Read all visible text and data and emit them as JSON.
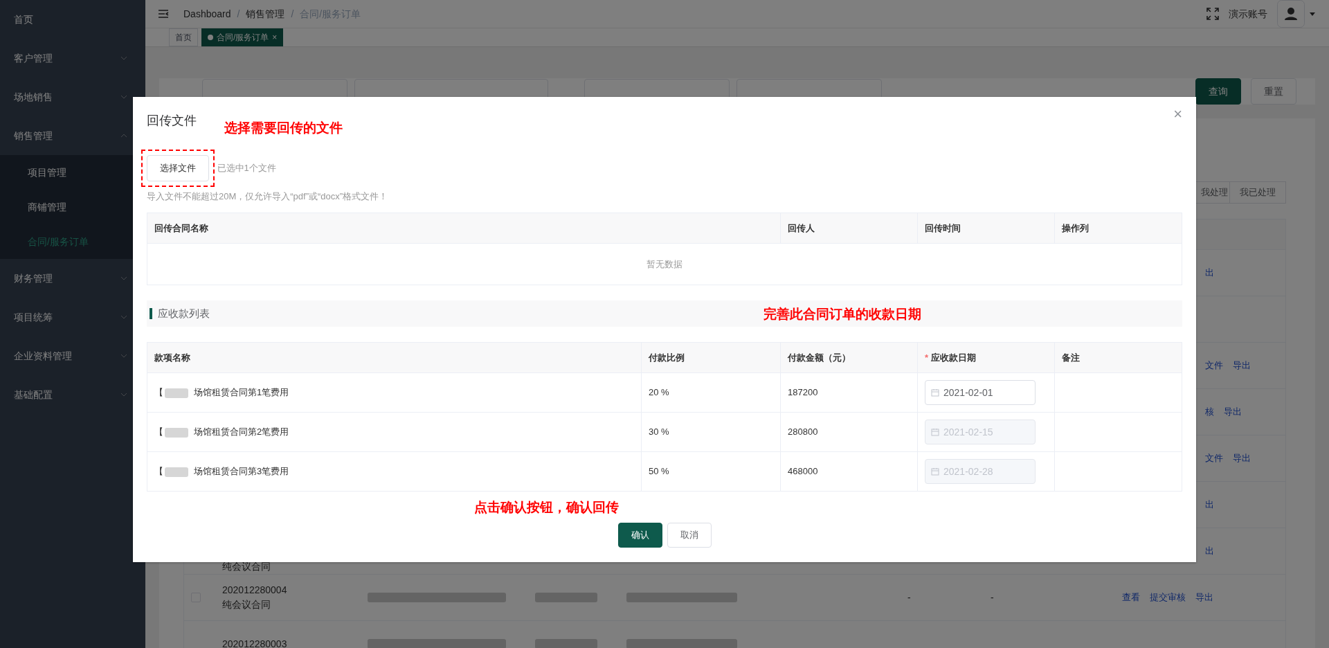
{
  "sidebar": {
    "items": [
      {
        "label": "首页"
      },
      {
        "label": "客户管理",
        "has_children": true,
        "expanded": false
      },
      {
        "label": "场地销售",
        "has_children": true,
        "expanded": false
      },
      {
        "label": "销售管理",
        "has_children": true,
        "expanded": true,
        "children": [
          {
            "label": "项目管理",
            "selected": false
          },
          {
            "label": "商铺管理",
            "selected": false
          },
          {
            "label": "合同/服务订单",
            "selected": true
          }
        ]
      },
      {
        "label": "财务管理",
        "has_children": true,
        "expanded": false
      },
      {
        "label": "项目统筹",
        "has_children": true,
        "expanded": false
      },
      {
        "label": "企业资料管理",
        "has_children": true,
        "expanded": false
      },
      {
        "label": "基础配置",
        "has_children": true,
        "expanded": false
      }
    ]
  },
  "header": {
    "breadcrumb": [
      "Dashboard",
      "销售管理",
      "合同/服务订单"
    ],
    "separators": [
      "/",
      "/"
    ],
    "account": "演示账号"
  },
  "page_tabs": [
    {
      "label": "首页",
      "selected": false,
      "closable": false
    },
    {
      "label": "合同/服务订单",
      "selected": true,
      "closable": true,
      "close": "×"
    }
  ],
  "search": {
    "buttons": [
      {
        "label": "查询",
        "kind": "primary"
      },
      {
        "label": "重置",
        "kind": "default"
      }
    ]
  },
  "list_tabs": [
    {
      "label": "我处理"
    },
    {
      "label": "我已处理"
    }
  ],
  "background_table": {
    "rows": [
      {
        "actions": [
          "出"
        ],
        "partial": true
      },
      {
        "actions": []
      },
      {
        "actions": [
          "文件",
          "导出"
        ],
        "partial": true
      },
      {
        "actions": [
          "核",
          "导出"
        ],
        "partial": true
      },
      {
        "actions": [
          "文件",
          "导出"
        ],
        "partial": true
      },
      {
        "actions": [
          "出"
        ],
        "partial": true
      },
      {
        "type": "纯会议合同",
        "actions": [
          "出"
        ],
        "partial": true
      },
      {
        "checked": false,
        "number": "202012280004",
        "type": "纯会议合同",
        "dashes": [
          "-",
          "-"
        ],
        "actions": [
          "查看",
          "提交审核",
          "导出"
        ],
        "partial": false
      },
      {
        "number": "202012280003",
        "actions": []
      }
    ]
  },
  "modal": {
    "title": "回传文件",
    "close": "×",
    "annotations": [
      "选择需要回传的文件",
      "完善此合同订单的收款日期",
      "点击确认按钮，确认回传"
    ],
    "choose_button": "选择文件",
    "selected_text": "已选中1个文件",
    "hint": "导入文件不能超过20M，仅允许导入“pdf”或“docx”格式文件！",
    "files_table": {
      "columns": [
        "回传合同名称",
        "回传人",
        "回传时间",
        "操作列"
      ],
      "empty_text": "暂无数据"
    },
    "section_title": "应收款列表",
    "payments_table": {
      "columns": [
        {
          "label": "款项名称",
          "required": false
        },
        {
          "label": "付款比例",
          "required": false
        },
        {
          "label": "付款金额（元）",
          "required": false
        },
        {
          "label": "应收款日期",
          "required": true,
          "required_mark": "*"
        },
        {
          "label": "备注",
          "required": false
        }
      ],
      "rows": [
        {
          "prefix": "【",
          "name": "场馆租赁合同第1笔费用",
          "ratio": "20 %",
          "amount": "187200",
          "date": "2021-02-01",
          "disabled": false
        },
        {
          "prefix": "【",
          "name": "场馆租赁合同第2笔费用",
          "ratio": "30 %",
          "amount": "280800",
          "date": "2021-02-15",
          "disabled": true
        },
        {
          "prefix": "【",
          "name": "场馆租赁合同第3笔费用",
          "ratio": "50 %",
          "amount": "468000",
          "date": "2021-02-28",
          "disabled": true
        }
      ]
    },
    "buttons": [
      {
        "label": "确认",
        "kind": "primary"
      },
      {
        "label": "取消",
        "kind": "default"
      }
    ]
  }
}
